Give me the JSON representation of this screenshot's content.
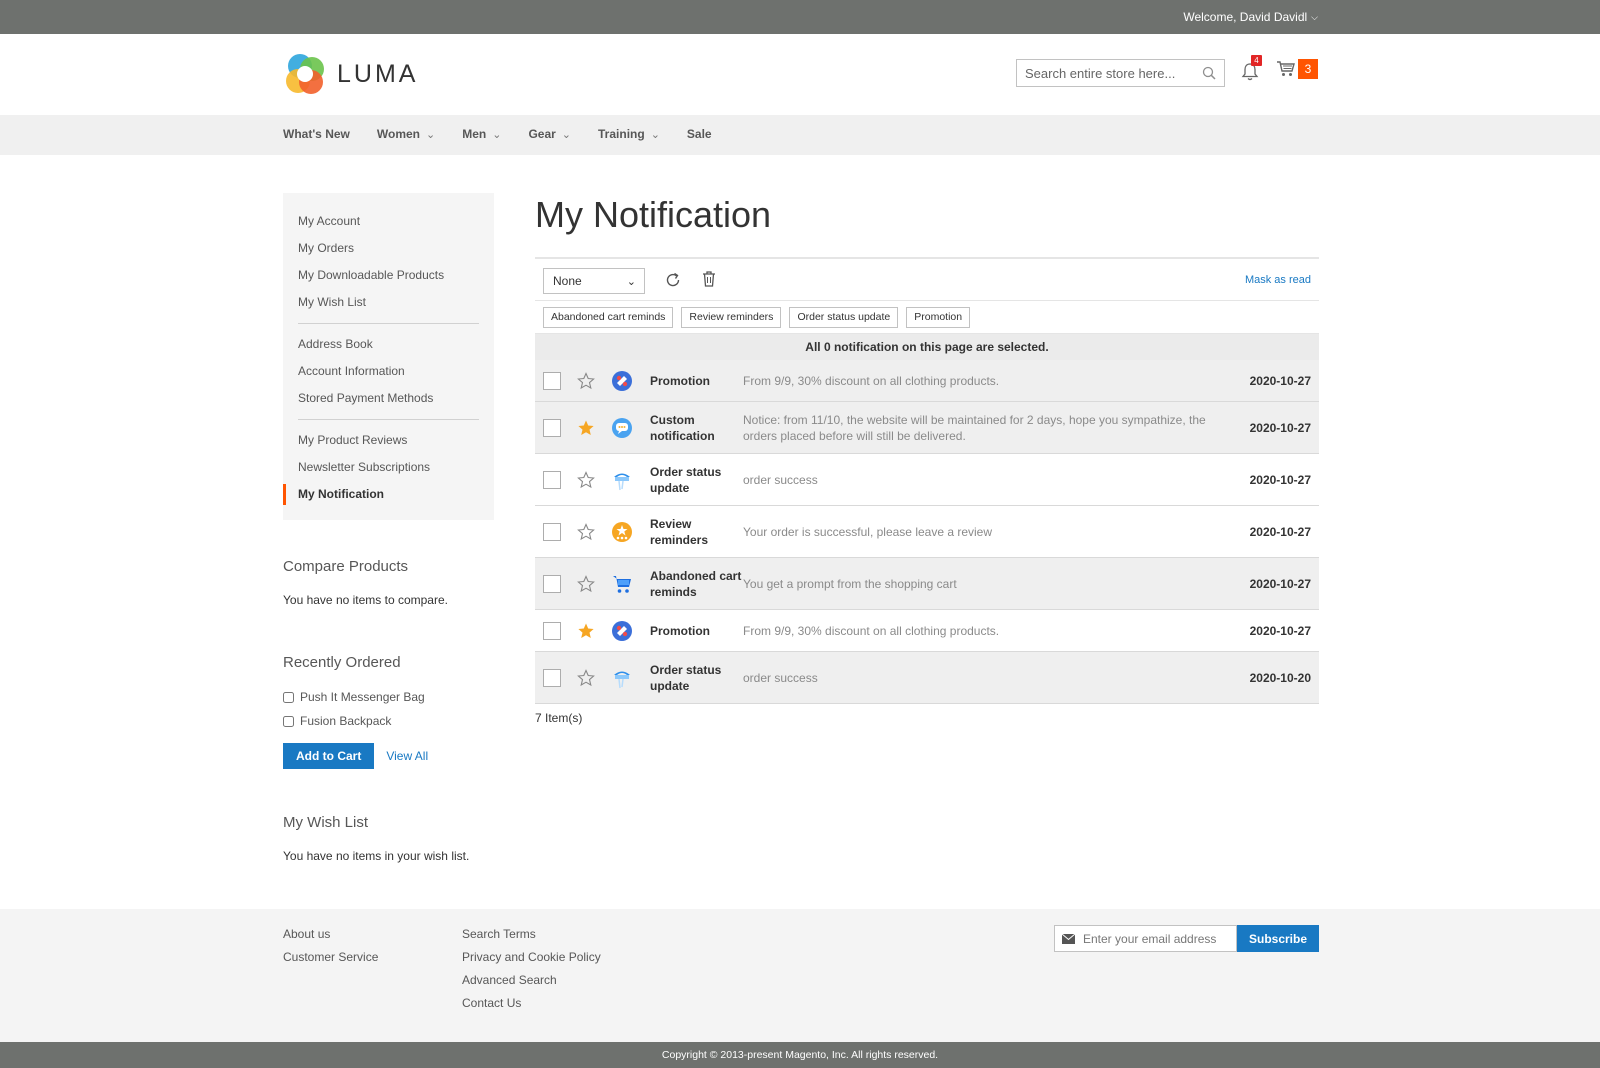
{
  "topbar": {
    "welcome": "Welcome, David Davidl"
  },
  "header": {
    "logo_text": "LUMA",
    "search_placeholder": "Search entire store here...",
    "notification_count": "4",
    "cart_count": "3"
  },
  "nav": {
    "items": [
      {
        "label": "What's New",
        "has_dropdown": false
      },
      {
        "label": "Women",
        "has_dropdown": true
      },
      {
        "label": "Men",
        "has_dropdown": true
      },
      {
        "label": "Gear",
        "has_dropdown": true
      },
      {
        "label": "Training",
        "has_dropdown": true
      },
      {
        "label": "Sale",
        "has_dropdown": false
      }
    ]
  },
  "sidebar": {
    "items": [
      "My Account",
      "My Orders",
      "My Downloadable Products",
      "My Wish List",
      "Address Book",
      "Account Information",
      "Stored Payment Methods",
      "My Product Reviews",
      "Newsletter Subscriptions",
      "My Notification"
    ],
    "active": "My Notification"
  },
  "compare": {
    "title": "Compare Products",
    "text": "You have no items to compare."
  },
  "recently_ordered": {
    "title": "Recently Ordered",
    "items": [
      "Push It Messenger Bag",
      "Fusion Backpack"
    ],
    "add_to_cart": "Add to Cart",
    "view_all": "View All"
  },
  "wishlist": {
    "title": "My Wish List",
    "text": "You have no items in your wish list."
  },
  "main": {
    "title": "My Notification",
    "select_value": "None",
    "mark_read": "Mask as read",
    "filters": [
      "Abandoned cart reminds",
      "Review reminders",
      "Order status update",
      "Promotion"
    ],
    "selected_text": "All 0 notification on this page are selected.",
    "rows": [
      {
        "starred": false,
        "icon": "promotion-icon",
        "type": "Promotion",
        "message": "From 9/9, 30% discount on all clothing products.",
        "date": "2020-10-27"
      },
      {
        "starred": true,
        "icon": "custom-notification-icon",
        "type": "Custom notification",
        "message": "Notice: from 11/10, the website will be maintained for 2 days, hope you sympathize, the orders placed before will still be delivered.",
        "date": "2020-10-27"
      },
      {
        "starred": false,
        "icon": "order-status-icon",
        "type": "Order status update",
        "message": "order success",
        "date": "2020-10-27"
      },
      {
        "starred": false,
        "icon": "review-reminder-icon",
        "type": "Review reminders",
        "message": "Your order is successful, please leave a review",
        "date": "2020-10-27"
      },
      {
        "starred": false,
        "icon": "cart-reminder-icon",
        "type": "Abandoned cart reminds",
        "message": "You get a prompt from the shopping cart",
        "date": "2020-10-27"
      },
      {
        "starred": true,
        "icon": "promotion-icon",
        "type": "Promotion",
        "message": "From 9/9, 30% discount on all clothing products.",
        "date": "2020-10-27"
      },
      {
        "starred": false,
        "icon": "order-status-icon",
        "type": "Order status update",
        "message": "order success",
        "date": "2020-10-20"
      }
    ],
    "item_count": "7 Item(s)"
  },
  "footer": {
    "col1": [
      "About us",
      "Customer Service"
    ],
    "col2": [
      "Search Terms",
      "Privacy and Cookie Policy",
      "Advanced Search",
      "Contact Us"
    ],
    "newsletter_placeholder": "Enter your email address",
    "subscribe": "Subscribe",
    "copyright": "Copyright © 2013-present Magento, Inc. All rights reserved."
  },
  "colors": {
    "accent": "#1979c3",
    "brand_orange": "#ff5501",
    "star": "#f6a623",
    "topbar": "#6e716e"
  }
}
